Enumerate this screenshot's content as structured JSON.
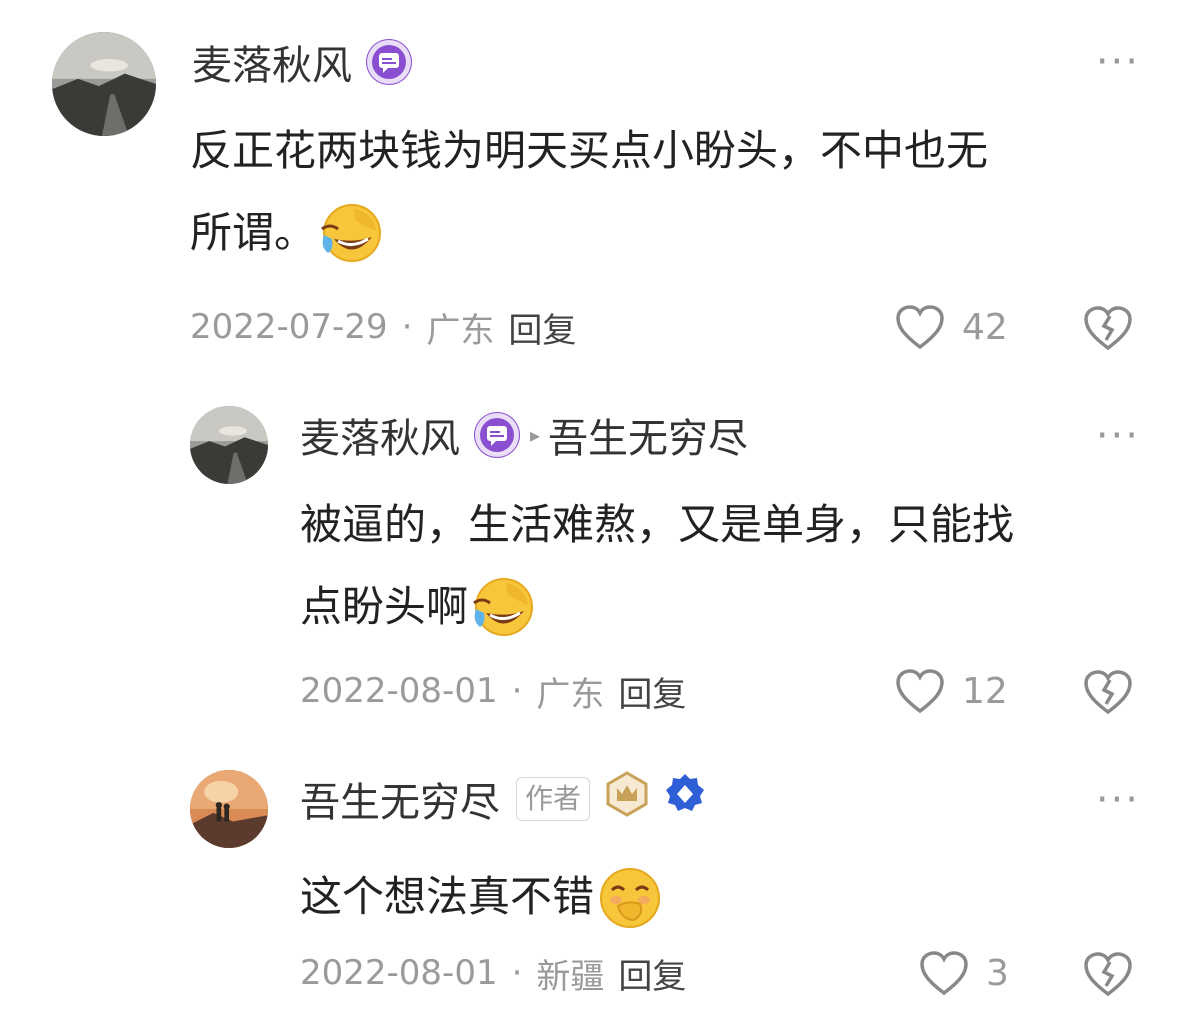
{
  "comments": [
    {
      "user": "麦落秋风",
      "text_line1": "反正花两块钱为明天买点小盼头，不中也无",
      "text_line2": "所谓。",
      "date": "2022-07-29",
      "location": "广东",
      "reply_label": "回复",
      "likes": "42"
    },
    {
      "user": "麦落秋风",
      "reply_to": "吾生无穷尽",
      "text_line1": "被逼的，生活难熬，又是单身，只能找",
      "text_line2": "点盼头啊",
      "date": "2022-08-01",
      "location": "广东",
      "reply_label": "回复",
      "likes": "12"
    },
    {
      "user": "吾生无穷尽",
      "author_tag": "作者",
      "text_line1": "这个想法真不错",
      "date": "2022-08-01",
      "location": "新疆",
      "reply_label": "回复",
      "likes": "3"
    }
  ],
  "separator_dot": "·",
  "more_label": "···",
  "reply_arrow": "▸",
  "colors": {
    "badge_purple": "#8a4fd0",
    "meta_gray": "#9a9a9a",
    "gold": "#c9a25a",
    "blue": "#2f5fd6"
  }
}
